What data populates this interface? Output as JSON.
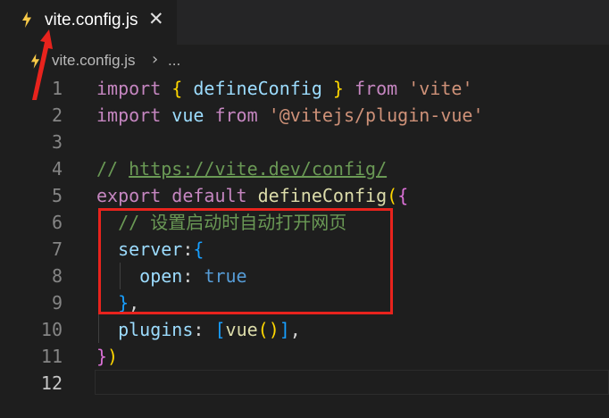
{
  "tab": {
    "label": "vite.config.js",
    "close": "✕"
  },
  "breadcrumb": {
    "file": "vite.config.js",
    "separator": "›",
    "more": "..."
  },
  "lines": [
    {
      "n": "1",
      "tokens": [
        [
          "import",
          "kw"
        ],
        [
          " ",
          "punc"
        ],
        [
          "{",
          "p1"
        ],
        [
          " defineConfig ",
          "var"
        ],
        [
          "}",
          "p1"
        ],
        [
          " ",
          "punc"
        ],
        [
          "from",
          "kw"
        ],
        [
          " ",
          "punc"
        ],
        [
          "'vite'",
          "str"
        ]
      ]
    },
    {
      "n": "2",
      "tokens": [
        [
          "import",
          "kw"
        ],
        [
          " ",
          "punc"
        ],
        [
          "vue",
          "var"
        ],
        [
          " ",
          "punc"
        ],
        [
          "from",
          "kw"
        ],
        [
          " ",
          "punc"
        ],
        [
          "'@vitejs/plugin-vue'",
          "str"
        ]
      ]
    },
    {
      "n": "3",
      "tokens": []
    },
    {
      "n": "4",
      "tokens": [
        [
          "// ",
          "cmt"
        ],
        [
          "https://vite.dev/config/",
          "url"
        ]
      ]
    },
    {
      "n": "5",
      "tokens": [
        [
          "export",
          "kw"
        ],
        [
          " ",
          "punc"
        ],
        [
          "default",
          "kw"
        ],
        [
          " ",
          "punc"
        ],
        [
          "defineConfig",
          "fn"
        ],
        [
          "(",
          "p1"
        ],
        [
          "{",
          "p2"
        ]
      ]
    },
    {
      "n": "6",
      "tokens": [
        [
          "  // 设置启动时自动打开网页",
          "cmt"
        ]
      ]
    },
    {
      "n": "7",
      "tokens": [
        [
          "  ",
          "punc"
        ],
        [
          "server",
          "var"
        ],
        [
          ":",
          "punc"
        ],
        [
          "{",
          "p3"
        ]
      ]
    },
    {
      "n": "8",
      "tokens": [
        [
          "    ",
          "punc"
        ],
        [
          "open",
          "var"
        ],
        [
          ": ",
          "punc"
        ],
        [
          "true",
          "bool"
        ]
      ]
    },
    {
      "n": "9",
      "tokens": [
        [
          "  ",
          "punc"
        ],
        [
          "}",
          "p3"
        ],
        [
          ",",
          "punc"
        ]
      ]
    },
    {
      "n": "10",
      "tokens": [
        [
          "  ",
          "punc"
        ],
        [
          "plugins",
          "var"
        ],
        [
          ": ",
          "punc"
        ],
        [
          "[",
          "p3"
        ],
        [
          "vue",
          "fn"
        ],
        [
          "()",
          "p1"
        ],
        [
          "]",
          "p3"
        ],
        [
          ",",
          "punc"
        ]
      ]
    },
    {
      "n": "11",
      "tokens": [
        [
          "}",
          "p2"
        ],
        [
          ")",
          "p1"
        ]
      ]
    },
    {
      "n": "12",
      "tokens": []
    }
  ],
  "active_line": "12",
  "colors": {
    "highlight": "#e8231d",
    "background": "#1e1e1e"
  }
}
